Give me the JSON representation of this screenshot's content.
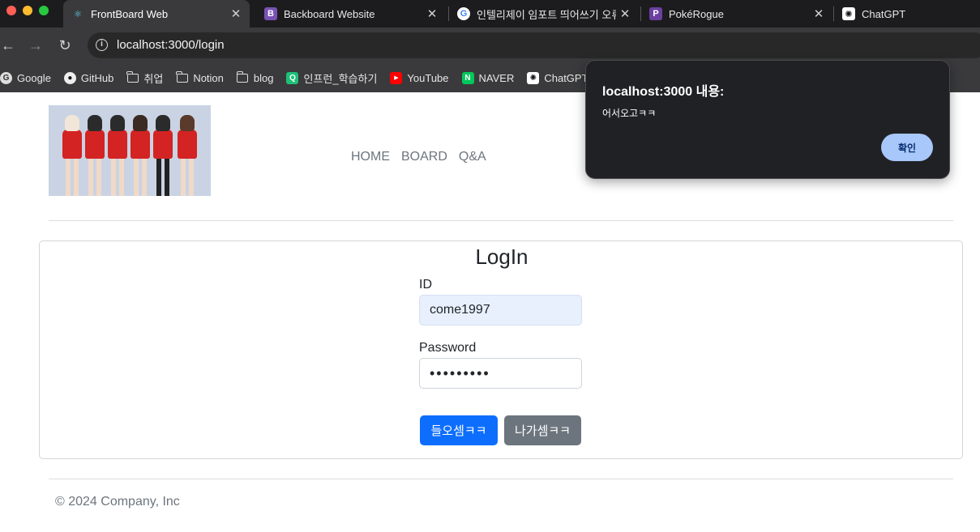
{
  "browser": {
    "tabs": [
      {
        "label": "FrontBoard Web",
        "favicon": "react-icon",
        "active": true
      },
      {
        "label": "Backboard Website",
        "favicon": "bootstrap-icon",
        "active": false
      },
      {
        "label": "인텔리제이 임포트 띄어쓰기 오류 -",
        "favicon": "google-icon",
        "active": false
      },
      {
        "label": "PokéRogue",
        "favicon": "pokerogue-icon",
        "active": false
      },
      {
        "label": "ChatGPT",
        "favicon": "chatgpt-icon",
        "active": false
      }
    ],
    "address": "localhost:3000/login",
    "bookmarks": [
      {
        "label": "Google",
        "icon": "google-icon"
      },
      {
        "label": "GitHub",
        "icon": "github-icon"
      },
      {
        "label": "취업",
        "icon": "folder-icon"
      },
      {
        "label": "Notion",
        "icon": "folder-icon"
      },
      {
        "label": "blog",
        "icon": "folder-icon"
      },
      {
        "label": "인프런_학습하기",
        "icon": "inflearn-icon"
      },
      {
        "label": "YouTube",
        "icon": "youtube-icon"
      },
      {
        "label": "NAVER",
        "icon": "naver-icon"
      },
      {
        "label": "ChatGPT",
        "icon": "chatgpt-icon"
      }
    ]
  },
  "site": {
    "nav": [
      "HOME",
      "BOARD",
      "Q&A"
    ],
    "footer": "© 2024 Company, Inc"
  },
  "login": {
    "title": "LogIn",
    "id_label": "ID",
    "id_value": "come1997",
    "password_label": "Password",
    "password_value": "•••••••••",
    "submit_label": "들오셈ㅋㅋ",
    "cancel_label": "나가셈ㅋㅋ"
  },
  "alert": {
    "title": "localhost:3000 내용:",
    "message": "어서오고ㅋㅋ",
    "ok_label": "확인"
  },
  "colors": {
    "primary": "#0d6efd",
    "secondary": "#6c757d",
    "autofill": "#e8f0fe",
    "dialog_bg": "#202124",
    "dialog_button": "#a8c7fa"
  }
}
